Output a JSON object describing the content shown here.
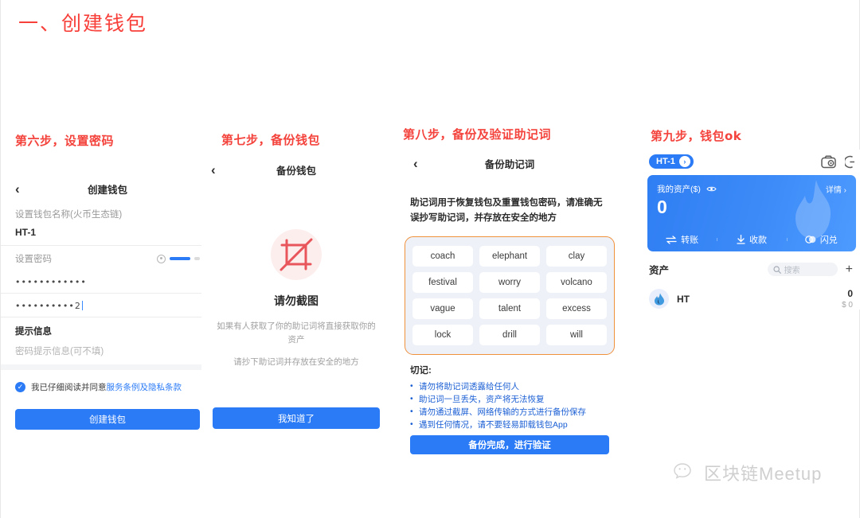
{
  "doc": {
    "title": "一、创建钱包",
    "watermark": "区块链Meetup"
  },
  "steps": {
    "six": "第六步，设置密码",
    "seven": "第七步，备份钱包",
    "eight": "第八步，备份及验证助记词",
    "nine": "第九步，钱包ok"
  },
  "panel_create_wallet": {
    "back_icon": "‹",
    "title": "创建钱包",
    "name_label": "设置钱包名称(火币生态链)",
    "name_value": "HT-1",
    "password_label": "设置密码",
    "password_value": "••••••••••••",
    "password_confirm_value": "••••••••••2",
    "hint_label": "提示信息",
    "hint_placeholder": "密码提示信息(可不填)",
    "agree_prefix": "我已仔细阅读并同意",
    "agree_link1": "服务条例",
    "agree_mid": "及",
    "agree_link2": "隐私条款",
    "submit_label": "创建钱包",
    "check_glyph": "✓"
  },
  "panel_backup_wallet": {
    "back_icon": "‹",
    "title": "备份钱包",
    "icon_name": "no-screenshot-icon",
    "headline": "请勿截图",
    "sub1": "如果有人获取了你的助记词将直接获取你的资产",
    "sub2": "请抄下助记词并存放在安全的地方",
    "button_label": "我知道了"
  },
  "panel_mnemonic": {
    "back_icon": "‹",
    "title": "备份助记词",
    "description": "助记词用于恢复钱包及重置钱包密码，请准确无误抄写助记词，并存放在安全的地方",
    "words": [
      "coach",
      "elephant",
      "clay",
      "festival",
      "worry",
      "volcano",
      "vague",
      "talent",
      "excess",
      "lock",
      "drill",
      "will"
    ],
    "notes_title": "切记:",
    "notes": [
      "请勿将助记词透露给任何人",
      "助记词一旦丢失，资产将无法恢复",
      "请勿通过截屏、网络传输的方式进行备份保存",
      "遇到任何情况，请不要轻易卸载钱包App"
    ],
    "button_label": "备份完成，进行验证"
  },
  "panel_wallet_home": {
    "wallet_chip": "HT-1",
    "chip_arrow": "›",
    "asset_label": "我的资产($)",
    "detail_label": "详情",
    "detail_arrow": "›",
    "amount": "0",
    "actions": [
      {
        "label": "转账",
        "icon": "transfer-icon"
      },
      {
        "label": "收款",
        "icon": "receive-icon"
      },
      {
        "label": "闪兑",
        "icon": "swap-icon"
      }
    ],
    "assets_title": "资产",
    "search_placeholder": "搜索",
    "add_glyph": "+",
    "coin_name": "HT",
    "coin_amount": "0",
    "coin_fiat": "$ 0"
  },
  "colors": {
    "accent_blue": "#2b7bf6",
    "title_red": "#f8403b",
    "mnemonic_border": "#f0913c",
    "note_blue": "#1b5fd4"
  }
}
